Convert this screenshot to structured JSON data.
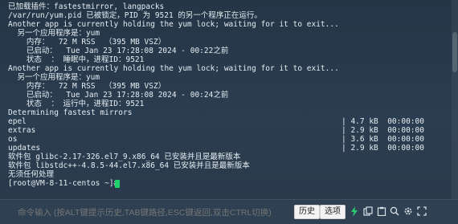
{
  "terminal": {
    "lines": [
      "已加载插件：fastestmirror, langpacks",
      "/var/run/yum.pid 已被锁定，PID 为 9521 的另一个程序正在运行。",
      "Another app is currently holding the yum lock; waiting for it to exit...",
      "  另一个应用程序是：yum",
      "    内存：  72 M RSS  （395 MB VSZ）",
      "    已启动：  Tue Jan 23 17:28:08 2024 - 00:22之前",
      "    状态  ： 睡眠中，进程ID：9521",
      "Another app is currently holding the yum lock; waiting for it to exit...",
      "  另一个应用程序是：yum",
      "    内存：  72 M RSS  （395 MB VSZ）",
      "    已启动：  Tue Jan 23 17:28:08 2024 - 00:24之前",
      "    状态  ： 运行中，进程ID：9521",
      "Determining fastest mirrors"
    ],
    "repos": [
      {
        "name": "epel",
        "info": "| 4.7 kB  00:00:00"
      },
      {
        "name": "extras",
        "info": "| 2.9 kB  00:00:00"
      },
      {
        "name": "os",
        "info": "| 3.6 kB  00:00:00"
      },
      {
        "name": "updates",
        "info": "| 2.9 kB  00:00:00"
      }
    ],
    "after": [
      "软件包 glibc-2.17-326.el7_9.x86_64 已安装并且是最新版本",
      "软件包 libstdc++-4.8.5-44.el7.x86_64 已安装并且是最新版本",
      "无须任何处理"
    ],
    "prompt": "[root@VM-8-11-centos ~]# "
  },
  "cmdbar": {
    "placeholder": "命令输入 (按ALT键提示历史,TAB键路径,ESC键返回,双击CTRL切换)",
    "history_label": "历史",
    "options_label": "选项"
  },
  "colors": {
    "terminal_bg": "#2a3b4c",
    "cursor": "#1fd36a",
    "lightning": "#2ecc71"
  },
  "icons": [
    "lightning-icon",
    "copy-icon",
    "paste-icon",
    "search-icon",
    "settings-icon",
    "fullscreen-icon"
  ]
}
